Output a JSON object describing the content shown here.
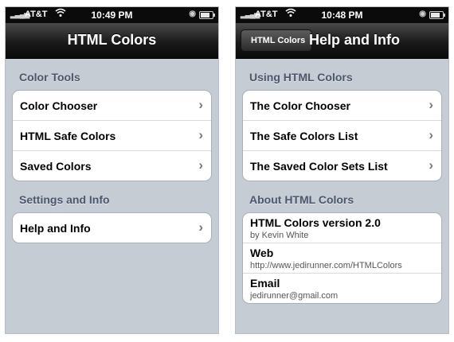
{
  "colors": {
    "nav_bg": "#111111",
    "grouped_bg": "#c5ccd4",
    "section_text": "#4c566c"
  },
  "left": {
    "status": {
      "carrier": "AT&T",
      "time": "10:49 PM"
    },
    "nav": {
      "title": "HTML Colors"
    },
    "sections": [
      {
        "header": "Color Tools",
        "items": [
          "Color Chooser",
          "HTML Safe Colors",
          "Saved Colors"
        ]
      },
      {
        "header": "Settings and Info",
        "items": [
          "Help and Info"
        ]
      }
    ]
  },
  "right": {
    "status": {
      "carrier": "AT&T",
      "time": "10:48 PM"
    },
    "nav": {
      "back": "HTML Colors",
      "title": "Help and Info"
    },
    "sections": [
      {
        "header": "Using HTML Colors",
        "items": [
          "The Color Chooser",
          "The Safe Colors List",
          "The Saved Color Sets List"
        ]
      },
      {
        "header": "About HTML Colors",
        "info": [
          {
            "title": "HTML Colors version 2.0",
            "detail": "by Kevin White"
          },
          {
            "title": "Web",
            "detail": "http://www.jedirunner.com/HTMLColors"
          },
          {
            "title": "Email",
            "detail": "jedirunner@gmail.com"
          }
        ]
      }
    ]
  },
  "icons": {
    "disclosure": "chevron-right-icon",
    "wifi": "wifi-icon",
    "battery": "battery-icon",
    "signal": "signal-icon",
    "lock": "rotation-lock-icon"
  }
}
